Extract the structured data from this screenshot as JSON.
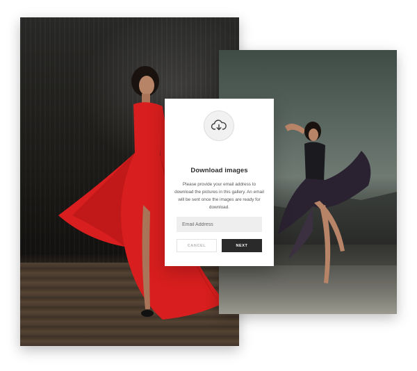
{
  "gallery": {
    "left_photo": {
      "subject": ""
    },
    "right_photo": {
      "subject": ""
    }
  },
  "modal": {
    "icon": "cloud-download-icon",
    "title": "Download images",
    "description": "Please provide your email address to download the pictures in this gallery. An email will be sent once the images are ready for download.",
    "email_placeholder": "Email Address",
    "email_value": "",
    "cancel_label": "CANCEL",
    "next_label": "NEXT"
  },
  "colors": {
    "primary_button": "#2a2a2a",
    "dress_red": "#d81e1e",
    "modal_background": "#ffffff"
  }
}
